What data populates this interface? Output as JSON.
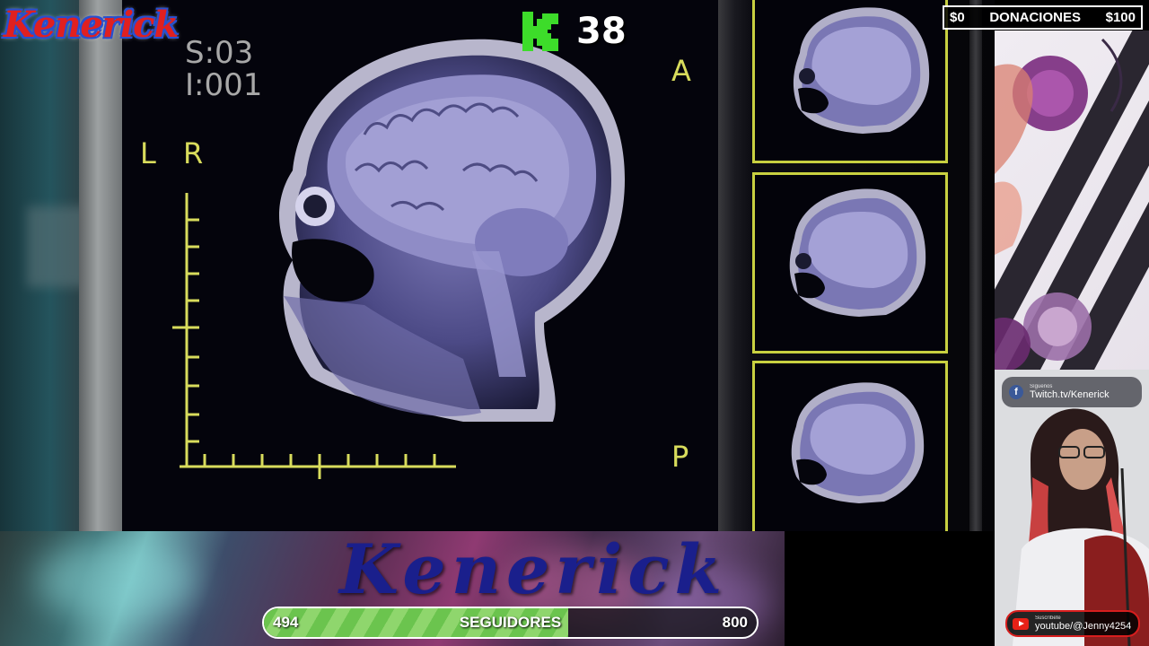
{
  "brand": {
    "logo_text": "Kenerick",
    "banner_text": "Kenerick"
  },
  "game": {
    "kill_count": "38",
    "mri": {
      "slice": "S:03",
      "image": "I:001",
      "orient_left": "L",
      "orient_right": "R",
      "orient_anterior": "A",
      "orient_posterior": "P"
    }
  },
  "donations": {
    "current": "$0",
    "label": "DONACIONES",
    "goal": "$100"
  },
  "followers": {
    "current": "494",
    "label": "SEGUIDORES",
    "goal": "800",
    "progress": 0.617
  },
  "social": {
    "facebook": {
      "prompt": "Síguenos",
      "handle": "Twitch.tv/Kenerick"
    },
    "youtube": {
      "prompt": "Suscríbete",
      "handle": "youtube/@Jenny4254"
    }
  },
  "icons": {
    "kill": "k-kill-icon",
    "facebook": "facebook-icon",
    "youtube": "youtube-icon"
  },
  "colors": {
    "accent_yellow": "#d8dc5c",
    "kill_green": "#3ddc2a",
    "logo_red": "#e02020",
    "banner_blue": "#1a1f8c",
    "progress_green": "#6bc44e"
  }
}
